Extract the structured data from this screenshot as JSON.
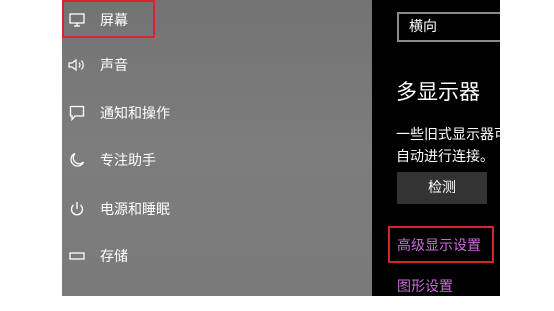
{
  "sidebar": {
    "items": [
      {
        "label": "屏幕",
        "icon": "monitor-icon"
      },
      {
        "label": "声音",
        "icon": "speaker-icon"
      },
      {
        "label": "通知和操作",
        "icon": "notification-icon"
      },
      {
        "label": "专注助手",
        "icon": "moon-icon"
      },
      {
        "label": "电源和睡眠",
        "icon": "power-icon"
      },
      {
        "label": "存储",
        "icon": "storage-icon"
      }
    ],
    "selected": "屏幕"
  },
  "content": {
    "orientation_value": "横向",
    "multi_display_title": "多显示器",
    "multi_display_desc": "一些旧式显示器可能不会自动进行连接。",
    "detect_button": "检测",
    "advanced_display_link": "高级显示设置",
    "graphics_link": "图形设置"
  },
  "colors": {
    "sidebar_bg": "#777777",
    "content_bg": "#000000",
    "link": "#c86bd6",
    "highlight_box": "#d7262b"
  }
}
